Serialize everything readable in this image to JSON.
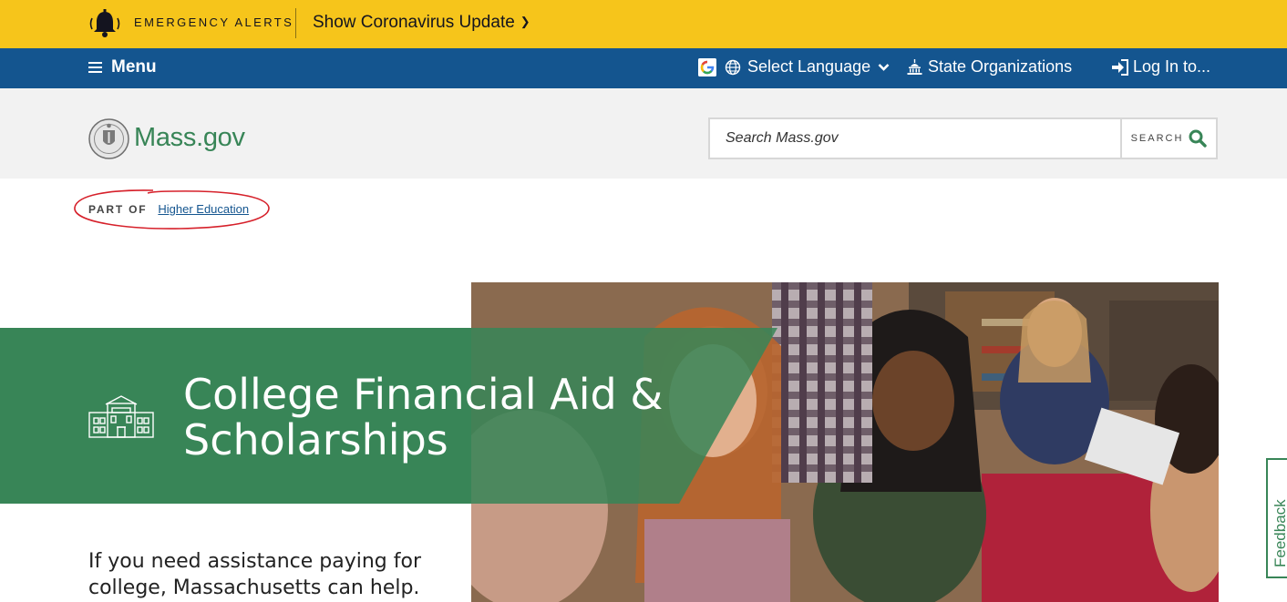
{
  "alerts": {
    "label": "EMERGENCY ALERTS",
    "update_button": "Show Coronavirus Update"
  },
  "utility_nav": {
    "menu": "Menu",
    "language": "Select Language",
    "organizations": "State Organizations",
    "login": "Log In to..."
  },
  "header": {
    "wordmark": "Mass.gov",
    "search_placeholder": "Search Mass.gov",
    "search_button": "SEARCH"
  },
  "breadcrumb": {
    "prefix": "PART OF",
    "link": "Higher Education"
  },
  "hero": {
    "title": "College Financial Aid & Scholarships",
    "lede": "If you need assistance paying for college, Massachusetts can help."
  },
  "feedback_tab": "Feedback",
  "icons": {
    "bell": "bell-icon",
    "menu": "hamburger-icon",
    "google": "google-icon",
    "globe": "globe-icon",
    "chevron": "chevron-down-icon",
    "capitol": "capitol-icon",
    "login": "sign-in-icon",
    "seal": "state-seal-icon",
    "search": "search-icon",
    "school": "school-building-icon"
  },
  "colors": {
    "alert_yellow": "#f6c51b",
    "nav_blue": "#14558f",
    "header_gray": "#f2f2f2",
    "brand_green": "#388557",
    "annotation_red": "#d6202a"
  }
}
